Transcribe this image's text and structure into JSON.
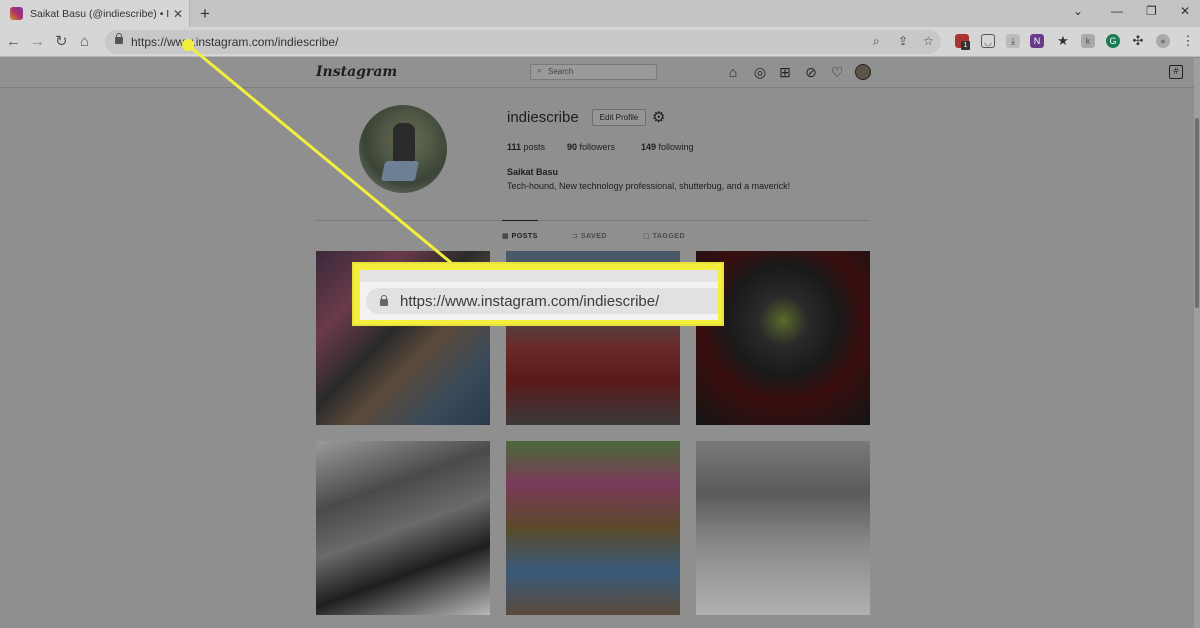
{
  "browser": {
    "tab_title": "Saikat Basu (@indiescribe) • Insta",
    "url": "https://www.instagram.com/indiescribe/",
    "ext_badge": "1"
  },
  "instagram": {
    "logo": "Instagram",
    "search_placeholder": "Search",
    "profile": {
      "username": "indiescribe",
      "edit_label": "Edit Profile",
      "posts_count": "111",
      "posts_label": "posts",
      "followers_count": "90",
      "followers_label": "followers",
      "following_count": "149",
      "following_label": "following",
      "full_name": "Saikat Basu",
      "bio": "Tech-hound, New technology professional, shutterbug, and a maverick!"
    },
    "tabs": [
      {
        "label": "POSTS",
        "icon": "grid-icon",
        "active": true
      },
      {
        "label": "SAVED",
        "icon": "bookmark-icon",
        "active": false
      },
      {
        "label": "TAGGED",
        "icon": "tag-icon",
        "active": false
      }
    ]
  },
  "callout": {
    "url": "https://www.instagram.com/indiescribe/",
    "color": "#f4ee3c"
  }
}
